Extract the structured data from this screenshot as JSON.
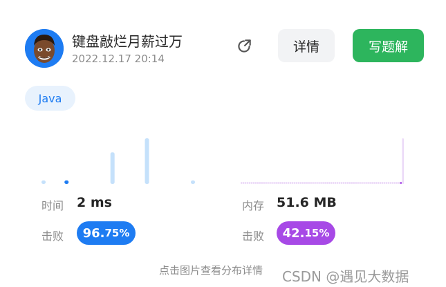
{
  "author": {
    "name": "键盘敲烂月薪过万",
    "time": "2022.12.17 20:14"
  },
  "actions": {
    "detail_label": "详情",
    "write_label": "写题解",
    "share_icon": "share-icon"
  },
  "tag": {
    "language": "Java"
  },
  "stats": {
    "time_label": "时间",
    "time_value": "2 ms",
    "time_beat_label": "击败",
    "time_beat_int": "96.",
    "time_beat_dec": "75%",
    "mem_label": "内存",
    "mem_value": "51.6 MB",
    "mem_beat_label": "击败",
    "mem_beat_int": "42.",
    "mem_beat_dec": "15%"
  },
  "colors": {
    "accent_green": "#2db55d",
    "accent_blue": "#1e7cf2",
    "accent_purple": "#a749e6",
    "bar_light_blue": "#c5e1fb",
    "bar_light_purple": "#ecdaf8"
  },
  "chart_data": [
    {
      "type": "bar",
      "name_hint": "runtime distribution",
      "values": [
        2,
        0,
        2,
        0,
        0,
        0,
        18,
        0,
        0,
        26,
        0,
        0,
        0,
        2
      ],
      "highlight_index": 2
    },
    {
      "type": "bar",
      "name_hint": "memory distribution",
      "values": [
        1,
        1,
        1,
        1,
        1,
        1,
        1,
        1,
        1,
        1,
        1,
        1,
        1,
        1,
        1,
        1,
        1,
        1,
        1,
        1,
        1,
        1,
        1,
        1,
        1,
        1,
        1,
        1,
        1,
        1,
        1,
        1,
        1,
        1,
        1,
        1,
        1,
        1,
        1,
        1,
        1,
        1,
        1,
        1,
        1,
        1,
        1,
        1,
        1,
        1,
        1,
        1,
        1,
        1,
        1,
        1,
        1,
        1,
        1,
        1,
        1,
        1,
        1,
        1,
        1,
        1,
        1,
        1,
        1,
        1,
        1,
        1,
        1,
        1,
        1,
        1,
        1,
        1,
        1,
        32
      ],
      "highlight_index": 78
    }
  ],
  "footer": {
    "hint": "点击图片查看分布详情",
    "watermark": "CSDN @遇见大数据"
  }
}
